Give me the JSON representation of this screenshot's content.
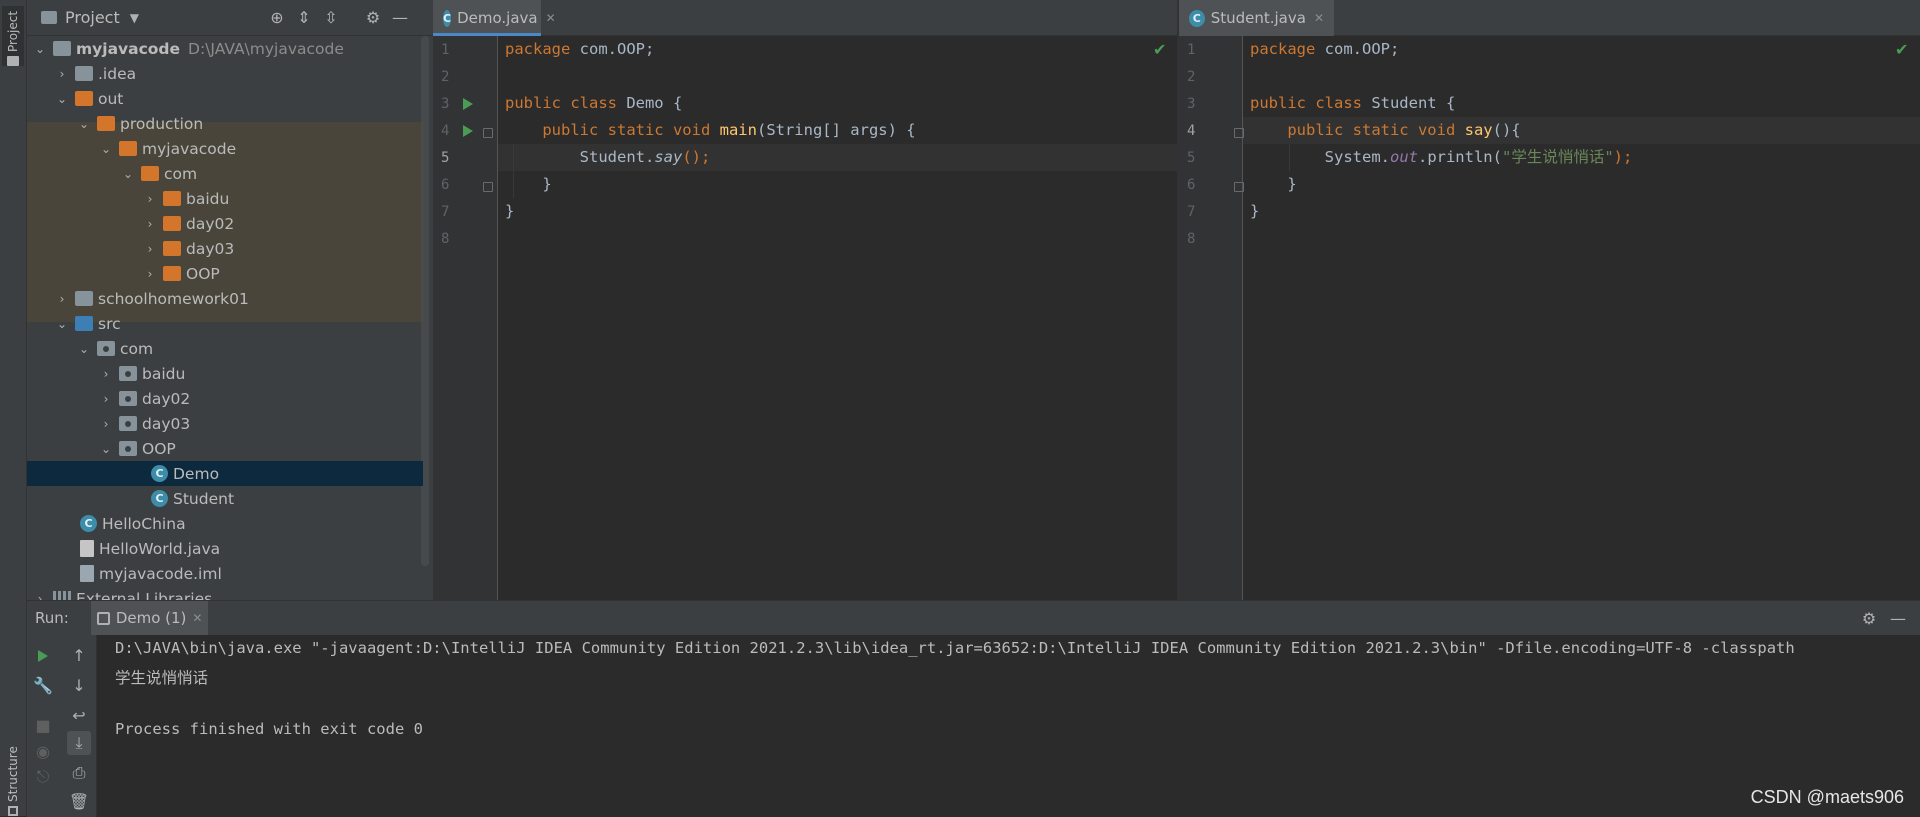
{
  "left_stripe": {
    "project_tab": "Project",
    "structure_tab": "Structure"
  },
  "project_panel": {
    "title": "Project",
    "tree": [
      {
        "label": "myjavacode",
        "path": "D:\\JAVA\\myjavacode",
        "icon": "module-folder-icon"
      },
      {
        "label": ".idea",
        "icon": "folder-icon"
      },
      {
        "label": "out",
        "icon": "excluded-folder-icon"
      },
      {
        "label": "production",
        "icon": "excluded-folder-icon"
      },
      {
        "label": "myjavacode",
        "icon": "excluded-folder-icon"
      },
      {
        "label": "com",
        "icon": "excluded-folder-icon"
      },
      {
        "label": "baidu",
        "icon": "excluded-folder-icon"
      },
      {
        "label": "day02",
        "icon": "excluded-folder-icon"
      },
      {
        "label": "day03",
        "icon": "excluded-folder-icon"
      },
      {
        "label": "OOP",
        "icon": "excluded-folder-icon"
      },
      {
        "label": "schoolhomework01",
        "icon": "folder-icon"
      },
      {
        "label": "src",
        "icon": "source-folder-icon"
      },
      {
        "label": "com",
        "icon": "package-icon"
      },
      {
        "label": "baidu",
        "icon": "package-icon"
      },
      {
        "label": "day02",
        "icon": "package-icon"
      },
      {
        "label": "day03",
        "icon": "package-icon"
      },
      {
        "label": "OOP",
        "icon": "package-icon"
      },
      {
        "label": "Demo",
        "icon": "java-class-icon"
      },
      {
        "label": "Student",
        "icon": "java-class-icon"
      },
      {
        "label": "HelloChina",
        "icon": "java-class-icon"
      },
      {
        "label": "HelloWorld.java",
        "icon": "java-file-icon"
      },
      {
        "label": "myjavacode.iml",
        "icon": "iml-file-icon"
      },
      {
        "label": "External Libraries",
        "icon": "library-icon"
      }
    ]
  },
  "editor_left": {
    "tab": "Demo.java",
    "lines": [
      "1",
      "2",
      "3",
      "4",
      "5",
      "6",
      "7",
      "8"
    ]
  },
  "editor_right": {
    "tab": "Student.java",
    "lines": [
      "1",
      "2",
      "3",
      "4",
      "5",
      "6",
      "7",
      "8"
    ]
  },
  "code_left": {
    "l1a": "package",
    "l1b": " com.OOP;",
    "l3a": "public class",
    "l3b": " Demo {",
    "l4a": "    public static void",
    "l4b": " main",
    "l4c": "(String[] args) {",
    "l5a": "        Student.",
    "l5b": "say",
    "l5c": "();",
    "l6": "    }",
    "l7": "}"
  },
  "code_right": {
    "l1a": "package",
    "l1b": " com.OOP;",
    "l3a": "public class",
    "l3b": " Student {",
    "l4a": "    public static void",
    "l4b": " say",
    "l4c": "(){",
    "l5a": "        System.",
    "l5b": "out",
    "l5c": ".println(",
    "l5d": "\"学生说悄悄话\"",
    "l5e": ");",
    "l6": "    }",
    "l7": "}"
  },
  "run_panel": {
    "label": "Run:",
    "tab": "Demo (1)",
    "console": [
      "D:\\JAVA\\bin\\java.exe \"-javaagent:D:\\IntelliJ IDEA Community Edition 2021.2.3\\lib\\idea_rt.jar=63652:D:\\IntelliJ IDEA Community Edition 2021.2.3\\bin\" -Dfile.encoding=UTF-8 -classpath",
      "学生说悄悄话",
      "",
      "Process finished with exit code 0"
    ]
  },
  "watermark": "CSDN @maets906",
  "colors": {
    "keyword": "#cc7832",
    "method": "#ffc66d",
    "string": "#6a8759",
    "static_field": "#9876aa",
    "selection": "#0d293e",
    "accent": "#4a88c7"
  }
}
